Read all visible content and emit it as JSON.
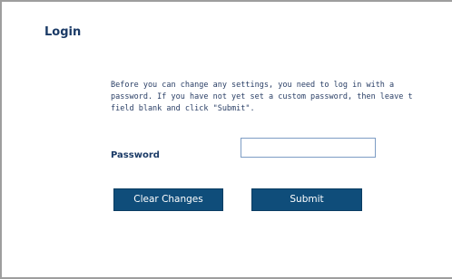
{
  "login": {
    "title": "Login",
    "intro_lines": [
      "Before you can change any settings, you need to log in with a",
      "password. If you have not yet set a custom password, then leave t",
      "field blank and click \"Submit\"."
    ],
    "password_label": "Password",
    "password_value": "",
    "clear_button_label": "Clear Changes",
    "submit_button_label": "Submit"
  },
  "colors": {
    "button_background": "#0f4d7a",
    "title_text": "#1a3a66",
    "body_text": "#2a3f66",
    "input_border": "#7d9cc4",
    "frame_border": "#9e9e9e"
  }
}
